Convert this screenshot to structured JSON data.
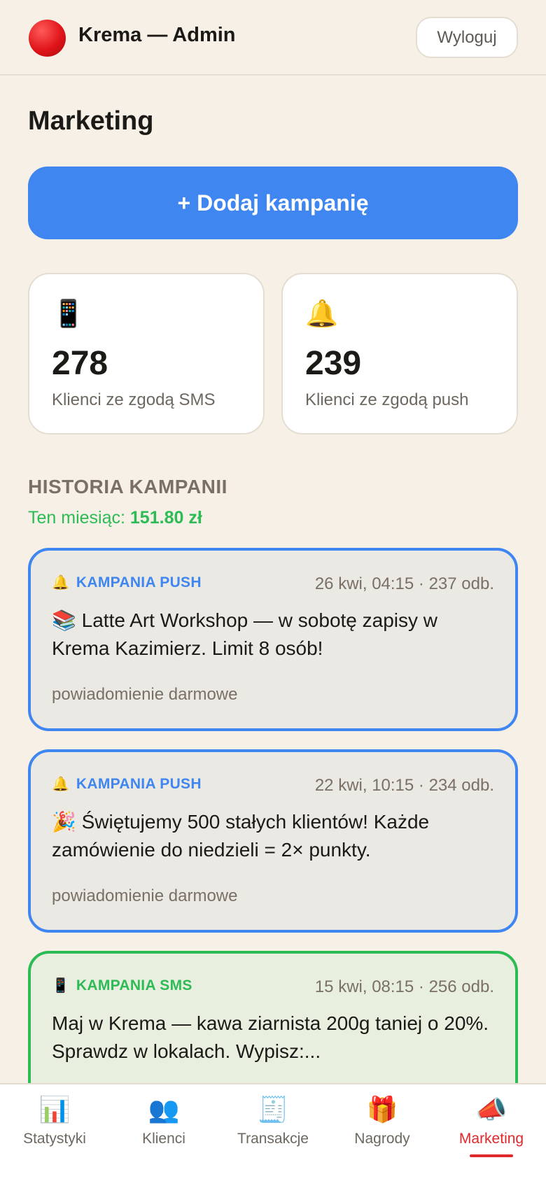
{
  "header": {
    "title": "Krema — Admin",
    "logout_label": "Wyloguj"
  },
  "page": {
    "title": "Marketing",
    "add_campaign_label": "+ Dodaj kampanię"
  },
  "stats": {
    "sms": {
      "icon": "📱",
      "value": "278",
      "label": "Klienci ze zgodą SMS"
    },
    "push": {
      "icon": "🔔",
      "value": "239",
      "label": "Klienci ze zgodą push"
    }
  },
  "history": {
    "title": "HISTORIA KAMPANII",
    "month_prefix": "Ten miesiąc:",
    "month_amount": "151.80 zł"
  },
  "campaigns": [
    {
      "type_icon": "🔔",
      "type_label": "KAMPANIA PUSH",
      "meta": "26 kwi, 04:15 · 237 odb.",
      "message": "📚 Latte Art Workshop — w sobotę zapisy w Krema Kazimierz. Limit 8 osób!",
      "note": "powiadomienie darmowe"
    },
    {
      "type_icon": "🔔",
      "type_label": "KAMPANIA PUSH",
      "meta": "22 kwi, 10:15 · 234 odb.",
      "message": "🎉 Świętujemy 500 stałych klientów! Każde zamówienie do niedzieli = 2× punkty.",
      "note": "powiadomienie darmowe"
    },
    {
      "type_icon": "📱",
      "type_label": "KAMPANIA SMS",
      "meta": "15 kwi, 08:15 · 256 odb.",
      "message": "Maj w Krema — kawa ziarnista 200g taniej o 20%. Sprawdz w lokalach. Wypisz:..."
    }
  ],
  "nav": [
    {
      "icon": "📊",
      "label": "Statystyki"
    },
    {
      "icon": "👥",
      "label": "Klienci"
    },
    {
      "icon": "🧾",
      "label": "Transakcje"
    },
    {
      "icon": "🎁",
      "label": "Nagrody"
    },
    {
      "icon": "📣",
      "label": "Marketing"
    }
  ],
  "colors": {
    "background": "#f6f0e6",
    "primary_blue": "#3f86f0",
    "sms_green": "#2dbb55",
    "active_red": "#e0282b"
  }
}
